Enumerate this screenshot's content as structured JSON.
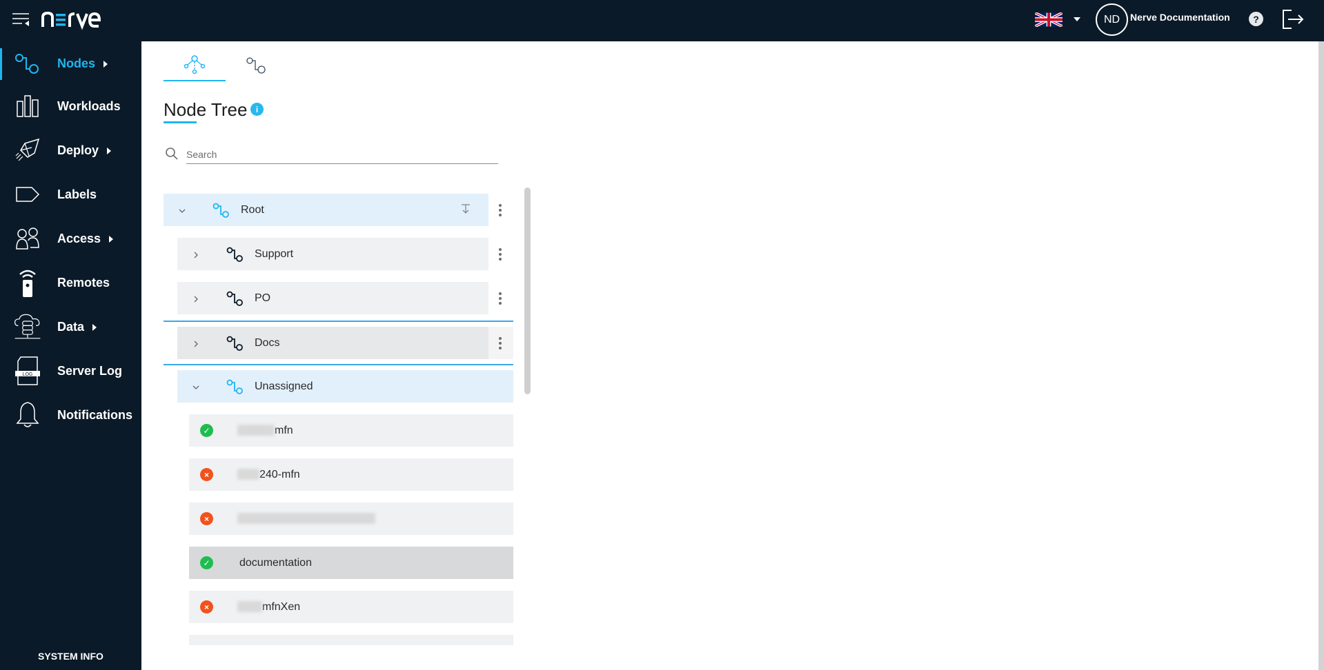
{
  "header": {
    "brand": "nerve",
    "language": "English (UK)",
    "avatar_initials": "ND",
    "username": "Nerve Documentation",
    "help_glyph": "?",
    "colors": {
      "background": "#0b1a28",
      "accent": "#1fb6f0"
    }
  },
  "sidebar": {
    "items": [
      {
        "label": "Nodes",
        "icon": "nodes-icon",
        "has_submenu": true,
        "active": true
      },
      {
        "label": "Workloads",
        "icon": "workloads-icon",
        "has_submenu": false
      },
      {
        "label": "Deploy",
        "icon": "rocket-icon",
        "has_submenu": true
      },
      {
        "label": "Labels",
        "icon": "label-tag-icon",
        "has_submenu": false
      },
      {
        "label": "Access",
        "icon": "users-icon",
        "has_submenu": true
      },
      {
        "label": "Remotes",
        "icon": "remote-icon",
        "has_submenu": false
      },
      {
        "label": "Data",
        "icon": "cloud-database-icon",
        "has_submenu": true
      },
      {
        "label": "Server Log",
        "icon": "log-file-icon",
        "has_submenu": false
      },
      {
        "label": "Notifications",
        "icon": "bell-icon",
        "has_submenu": false
      }
    ],
    "system_info": "SYSTEM INFO",
    "log_icon_text": "LOG"
  },
  "main": {
    "tabs": [
      {
        "name": "node-tree",
        "icon": "tree-icon",
        "active": true
      },
      {
        "name": "node-list",
        "icon": "nodes-icon",
        "active": false
      }
    ],
    "title": "Node Tree",
    "info_glyph": "i",
    "search": {
      "placeholder": "Search",
      "value": ""
    },
    "tree": {
      "root": {
        "label": "Root",
        "expanded": true
      },
      "children": [
        {
          "label": "Support",
          "expanded": false
        },
        {
          "label": "PO",
          "expanded": false
        },
        {
          "label": "Docs",
          "expanded": false
        },
        {
          "label": "Unassigned",
          "expanded": true
        }
      ],
      "unassigned_nodes": [
        {
          "label_visible": "mfn",
          "status": "online",
          "redacted_prefix": true
        },
        {
          "label_visible": "240-mfn",
          "status": "offline",
          "redacted_prefix": true
        },
        {
          "label_visible": "",
          "status": "offline",
          "redacted_prefix": true
        },
        {
          "label_visible": "documentation",
          "status": "online",
          "redacted_prefix": false
        },
        {
          "label_visible": "mfnXen",
          "status": "offline",
          "redacted_prefix": true
        }
      ],
      "status_glyphs": {
        "online": "✓",
        "offline": "×"
      }
    }
  }
}
